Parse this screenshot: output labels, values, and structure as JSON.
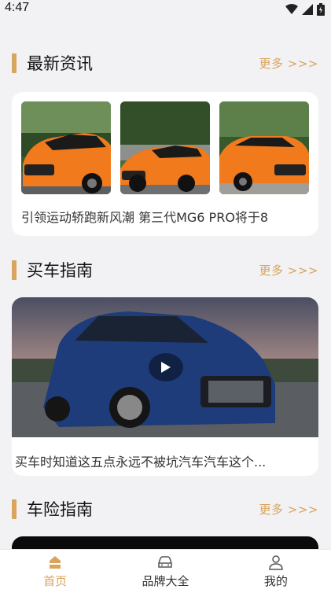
{
  "status": {
    "time": "4:47"
  },
  "sections": {
    "news": {
      "title": "最新资讯",
      "more": "更多 >>>",
      "headline": "引领运动轿跑新风潮 第三代MG6 PRO将于8"
    },
    "guide": {
      "title": "买车指南",
      "more": "更多 >>>",
      "video_title": "买车时知道这五点永远不被坑汽车汽车这个..."
    },
    "insurance": {
      "title": "车险指南",
      "more": "更多 >>>"
    }
  },
  "tabbar": {
    "items": [
      {
        "label": "首页",
        "icon": "home-icon",
        "active": true
      },
      {
        "label": "品牌大全",
        "icon": "car-icon",
        "active": false
      },
      {
        "label": "我的",
        "icon": "user-icon",
        "active": false
      }
    ]
  },
  "colors": {
    "accent": "#d9a45c",
    "background": "#f2f2f4",
    "card": "#ffffff"
  }
}
